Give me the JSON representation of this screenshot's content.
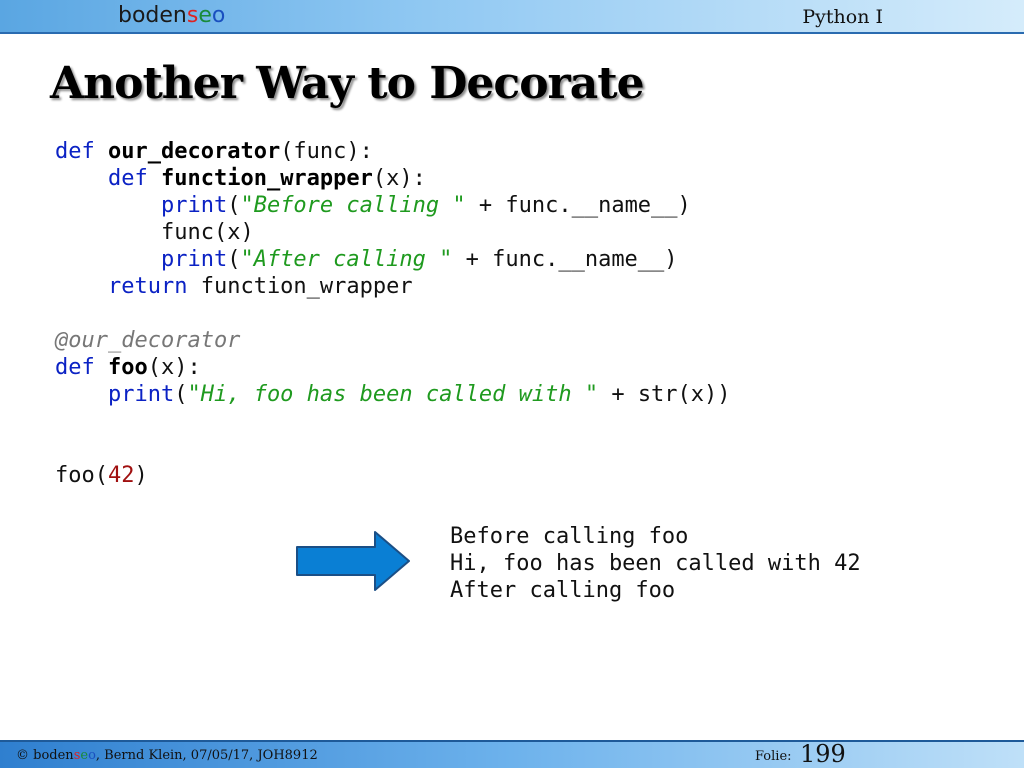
{
  "header": {
    "logo": {
      "part1": "boden",
      "part2": "s",
      "part3": "e",
      "part4": "o"
    },
    "course": "Python I"
  },
  "slide": {
    "title": "Another Way to Decorate",
    "code": {
      "l1": {
        "kw": "def",
        "name": "our_decorator",
        "rest": "(func):"
      },
      "l2": {
        "indent": "    ",
        "kw": "def",
        "name": "function_wrapper",
        "rest": "(x):"
      },
      "l3": {
        "indent": "        ",
        "fn": "print",
        "open": "(",
        "str": "\"Before calling \"",
        "rest": " + func.__name__)"
      },
      "l4": {
        "indent": "        ",
        "text": "func(x)"
      },
      "l5": {
        "indent": "        ",
        "fn": "print",
        "open": "(",
        "str": "\"After calling \"",
        "rest": " + func.__name__)"
      },
      "l6": {
        "indent": "    ",
        "kw": "return",
        "rest": " function_wrapper"
      },
      "l8": {
        "dec": "@our_decorator"
      },
      "l9": {
        "kw": "def",
        "name": "foo",
        "rest": "(x):"
      },
      "l10": {
        "indent": "    ",
        "fn": "print",
        "open": "(",
        "str": "\"Hi, foo has been called with \"",
        "rest": " + str(x))"
      },
      "l13": {
        "call": "foo(",
        "num": "42",
        "close": ")"
      }
    },
    "output": [
      "Before calling foo",
      "Hi, foo has been called with 42",
      "After calling foo"
    ]
  },
  "footer": {
    "copyright": "© ",
    "logo": {
      "part1": "boden",
      "part2": "s",
      "part3": "e",
      "part4": "o"
    },
    "info": ", Bernd Klein, 07/05/17, JOH8912",
    "folie_label": "Folie:",
    "folie_number": "199"
  },
  "colors": {
    "arrow_fill": "#0a7fd4",
    "arrow_stroke": "#1b4f86",
    "keyword": "#0b22c4",
    "string": "#1f9a1f",
    "number": "#a01010"
  }
}
